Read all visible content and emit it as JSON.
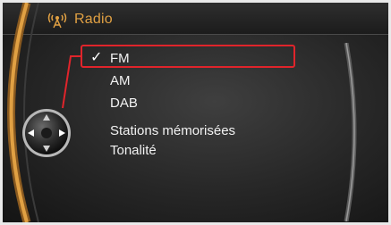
{
  "header": {
    "title": "Radio",
    "icon": "radio-signal-icon",
    "title_color": "#e0a043"
  },
  "menu": {
    "items": [
      {
        "label": "FM",
        "selected": true
      },
      {
        "label": "AM",
        "selected": false
      },
      {
        "label": "DAB",
        "selected": false
      },
      {
        "label": "Stations mémorisées",
        "selected": false
      },
      {
        "label": "Tonalité",
        "selected": false
      }
    ],
    "check_mark": "✓"
  },
  "colors": {
    "accent_orange": "#e0a043",
    "highlight_red": "#e0242b",
    "text": "#f2f2f2",
    "background": "#262626"
  },
  "controller": {
    "icon": "idrive-controller-icon"
  }
}
